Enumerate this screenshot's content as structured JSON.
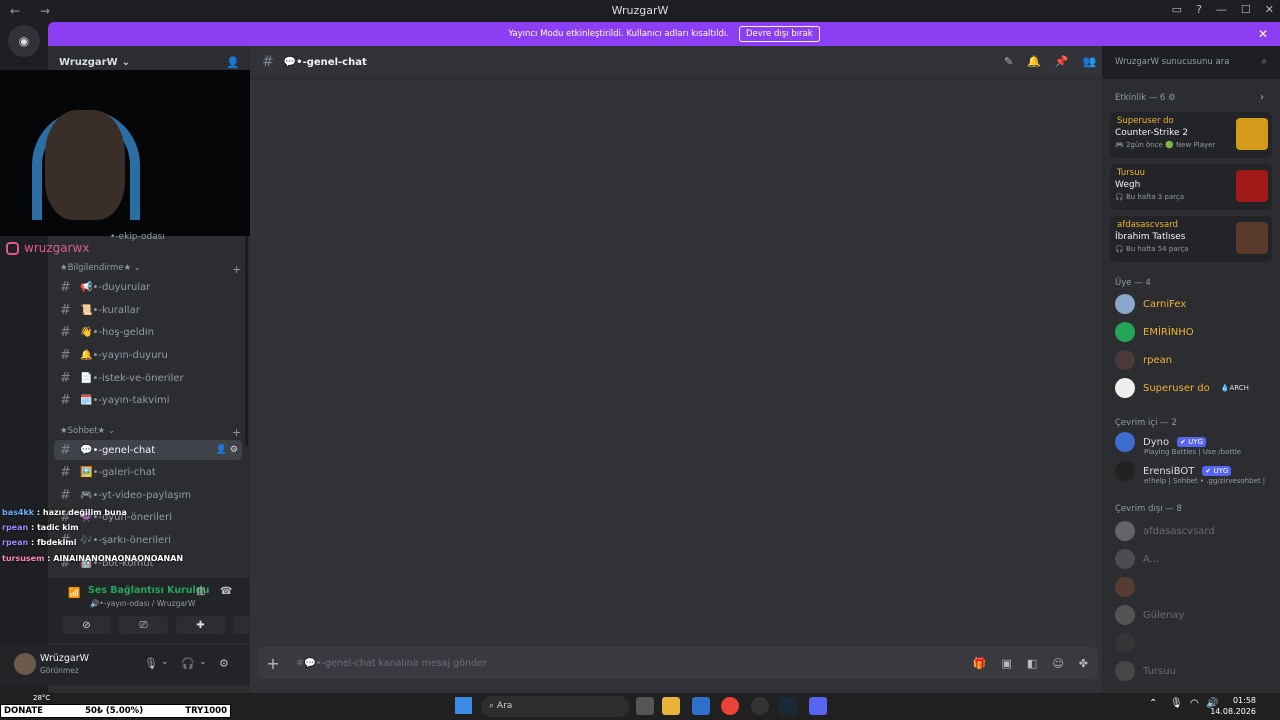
{
  "window": {
    "title": "WruzgarW"
  },
  "banner": {
    "text": "Yayıncı Modu etkinleştirildi. Kullanıcı adları kısaltıldı.",
    "button": "Devre dışı bırak"
  },
  "server": {
    "name": "WruzgarW"
  },
  "overlay": {
    "instagram": "wruzgarwx"
  },
  "sidebar": {
    "partial_channel": "•-ekip-odası",
    "cat_info": "★Bilgilendirme★",
    "info_channels": [
      "📢•-duyurular",
      "📜•-kurallar",
      "👋•-hoş-geldin",
      "🔔•-yayın-duyuru",
      "📄•-istek-ve-öneriler",
      "🗓️•-yayın-takvimi"
    ],
    "cat_chat": "★Sohbet★",
    "chat_channels": [
      "💬•-genel-chat",
      "🖼️•-galeri-chat",
      "🎮•-yt-video-paylaşım",
      "👾•-oyun-önerileri",
      "🎶•-şarkı-önerileri",
      "🤖•-bot-komut"
    ]
  },
  "chat_overlay": [
    {
      "user": "bas4kk",
      "msg": "hazır değilim buna",
      "color": "#6ab0ff"
    },
    {
      "user": "rpean",
      "msg": "tadic kim",
      "color": "#9b8cff"
    },
    {
      "user": "rpean",
      "msg": "fbdekimi",
      "color": "#9b8cff"
    },
    {
      "user": "tursusem",
      "msg": "AINAINANONAONAONOANAN",
      "color": "#ff8ab3"
    }
  ],
  "voice": {
    "status": "Ses Bağlantısı Kuruldu",
    "sub": "🔊•-yayın-odası / WruzgarW"
  },
  "user": {
    "name": "WrüzgarW",
    "status": "Görünmez"
  },
  "channel": {
    "name": "💬•-genel-chat",
    "placeholder": "#💬•-genel-chat kanalına mesaj gönder"
  },
  "search": {
    "placeholder": "WruzgarW sunucusunu ara"
  },
  "activity": {
    "header": "Etkinlik — 6",
    "items": [
      {
        "user": "Superuser do",
        "title": "Counter-Strike 2",
        "info": "🎮 2gün önce  🟢 New Player",
        "thumb": "#d49a1a"
      },
      {
        "user": "Tursuu",
        "title": "Wegh",
        "info": "🎧 Bu hafta 3 parça",
        "thumb": "#a01818"
      },
      {
        "user": "afdasascvsard",
        "title": "İbrahim Tatlıses",
        "info": "🎧 Bu hafta 54 parça",
        "thumb": "#5a3a2a"
      }
    ]
  },
  "members_header": "Üye — 4",
  "members": [
    {
      "name": "CarniFex",
      "color": "#f0b232",
      "av": "#8aa6c9"
    },
    {
      "name": "EMİRİNHO",
      "color": "#f0b232",
      "av": "#23a55a"
    },
    {
      "name": "rpean",
      "color": "#f0b232",
      "av": "#4a3a3a"
    },
    {
      "name": "Superuser do",
      "color": "#f0b232",
      "av": "#eeeeee",
      "tag": "💧ARCH"
    }
  ],
  "online_header": "Çevrim içi — 2",
  "online": [
    {
      "name": "Dyno",
      "tag": "✔ UYG",
      "sub": "Playing Battles | Use /battle",
      "av": "#3b6ecf"
    },
    {
      "name": "ErensiBOT",
      "tag": "✔ UYG",
      "sub": "e!help | Sohbet • .gg/zirvesohbet |",
      "av": "#222222"
    }
  ],
  "offline_header": "Çevrim dışı — 8",
  "offline": [
    {
      "name": "afdasascvsard",
      "av": "#cccccc"
    },
    {
      "name": "A...",
      "av": "#888888"
    },
    {
      "name": "",
      "av": "#a05a3a"
    },
    {
      "name": "Gülenay",
      "av": "#9a9a9a"
    },
    {
      "name": "",
      "av": "#444444"
    },
    {
      "name": "Tursuu",
      "av": "#777777"
    }
  ],
  "taskbar": {
    "search": "Ara",
    "time": "01:58",
    "date": "14.08.2026",
    "weather": "28°C"
  },
  "donate": {
    "label": "DONATE",
    "progress": "50₺ (5.00%)",
    "goal": "TRY1000"
  }
}
